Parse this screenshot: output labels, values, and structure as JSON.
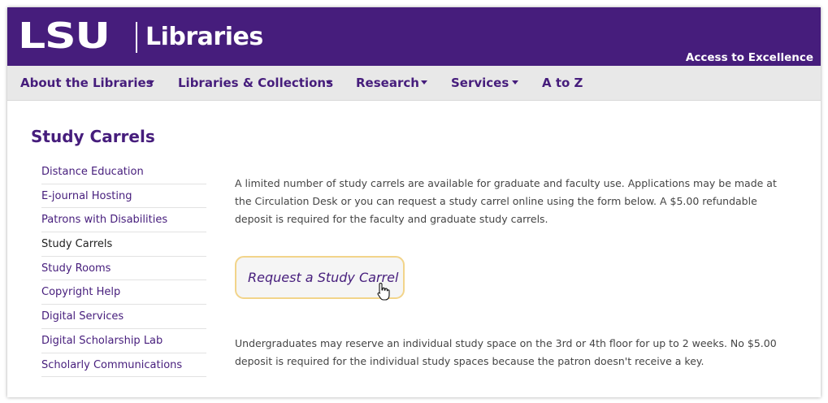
{
  "header": {
    "logo_text": "LSU",
    "site_name": "Libraries",
    "tagline": "Access to Excellence",
    "background_color": "#461d7c"
  },
  "nav": {
    "items": [
      {
        "label": "About the Libraries",
        "has_dropdown": true
      },
      {
        "label": "Libraries & Collections",
        "has_dropdown": true
      },
      {
        "label": "Research",
        "has_dropdown": true
      },
      {
        "label": "Services",
        "has_dropdown": true
      },
      {
        "label": "A to Z",
        "has_dropdown": false
      }
    ]
  },
  "page": {
    "title": "Study Carrels"
  },
  "sidebar": {
    "items": [
      {
        "label": "Distance Education",
        "current": false
      },
      {
        "label": "E-journal Hosting",
        "current": false
      },
      {
        "label": "Patrons with Disabilities",
        "current": false
      },
      {
        "label": "Study Carrels",
        "current": true
      },
      {
        "label": "Study Rooms",
        "current": false
      },
      {
        "label": "Copyright Help",
        "current": false
      },
      {
        "label": "Digital Services",
        "current": false
      },
      {
        "label": "Digital Scholarship Lab",
        "current": false
      },
      {
        "label": "Scholarly Communications",
        "current": false
      }
    ]
  },
  "content": {
    "paragraph_1": "A limited number of study carrels are available for graduate and faculty use.  Applications may be made at the Circulation Desk or you can request a study carrel online using the form below. A $5.00 refundable deposit is required for the faculty and graduate study carrels.",
    "request_button_label": "Request a Study Carrel",
    "paragraph_2": "Undergraduates may reserve an individual study space on the 3rd or 4th floor for up to 2 weeks. No $5.00 deposit is required for the individual study spaces because the patron doesn't receive a key."
  },
  "colors": {
    "brand_purple": "#461d7c",
    "button_border": "#f2d48a",
    "nav_background": "#e8e8e8"
  },
  "icons": {
    "cursor": "hand-pointer-icon"
  }
}
